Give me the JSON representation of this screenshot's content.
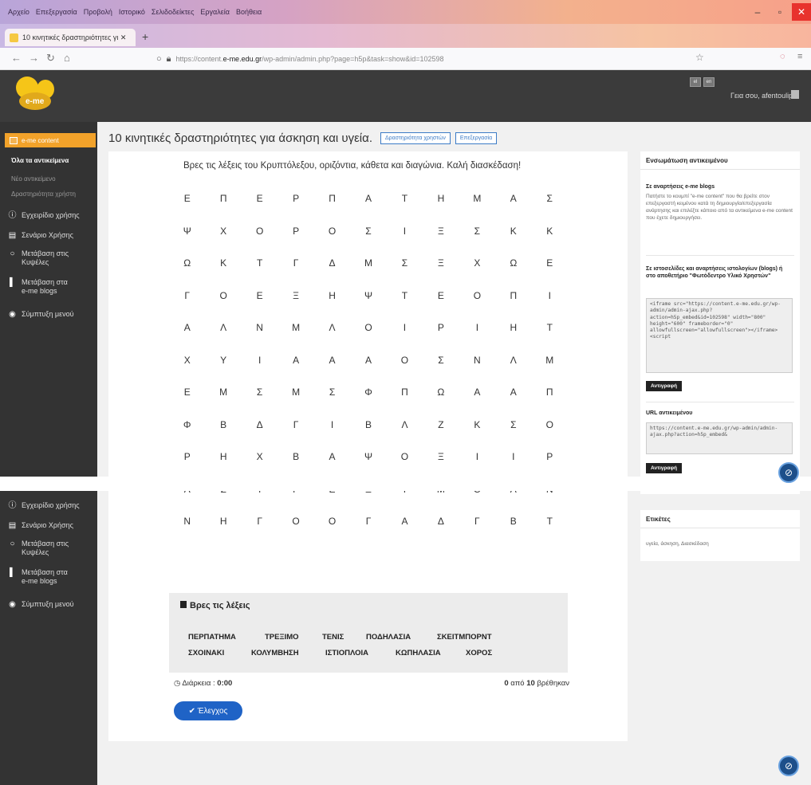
{
  "browser": {
    "menu_items": [
      "Αρχείο",
      "Επεξεργασία",
      "Προβολή",
      "Ιστορικό",
      "Σελιδοδείκτες",
      "Εργαλεία",
      "Βοήθεια"
    ],
    "tab_title": "10 κινητικές δραστηριότητες γι ✕",
    "new_tab": "+",
    "url_prefix": "https://content.",
    "url_domain": "e-me.edu.gr",
    "url_path": "/wp-admin/admin.php?page=h5p&task=show&id=102598",
    "colors": {
      "title_bar_start": "#b9a5d9",
      "title_bar_end": "#f7a089",
      "close_button": "#e8322d"
    }
  },
  "site": {
    "logo_text": "e-me",
    "lang_buttons": [
      "el",
      "en"
    ],
    "greeting": "Γεια σου, afentoulip",
    "accent": "#f2a22a",
    "header_bg": "#3b3b3b"
  },
  "sidebar": {
    "active_item": "e-me content",
    "sub_items": [
      "Όλα τα αντικείμενα",
      "Νέο αντικείμενο",
      "Δραστηριότητα χρήστη"
    ],
    "items_top": [
      {
        "icon": "question-icon",
        "label": "Εγχειρίδιο χρήσης"
      },
      {
        "icon": "document-icon",
        "label": "Σενάριο Χρήσης"
      },
      {
        "icon": "circle-icon",
        "label": "Μετάβαση στις Κυψέλες"
      },
      {
        "icon": "bar-icon",
        "label": "Μετάβαση στα e-me blogs"
      },
      {
        "icon": "collapse-icon",
        "label": "Σύμπτυξη μενού"
      }
    ],
    "items_bottom": [
      {
        "icon": "question-icon",
        "label": "Εγχειρίδιο χρήσης"
      },
      {
        "icon": "document-icon",
        "label": "Σενάριο Χρήσης"
      },
      {
        "icon": "circle-icon",
        "label": "Μετάβαση στις Κυψέλες"
      },
      {
        "icon": "bar-icon",
        "label": "Μετάβαση στα e-me blogs"
      },
      {
        "icon": "collapse-icon",
        "label": "Σύμπτυξη μενού"
      }
    ]
  },
  "main": {
    "title": "10 κινητικές δραστηριότητες για άσκηση και υγεία.",
    "btn_activity": "Δραστηριότητα χρηστών",
    "btn_edit": "Επεξεργασία",
    "instruction": "Βρες τις λέξεις του Κρυπτόλεξου, οριζόντια, κάθετα και διαγώνια. Καλή διασκέδαση!",
    "grid": [
      [
        "Ε",
        "Π",
        "Ε",
        "Ρ",
        "Π",
        "Α",
        "Τ",
        "Η",
        "Μ",
        "Α",
        "Σ"
      ],
      [
        "Ψ",
        "Χ",
        "Ο",
        "Ρ",
        "Ο",
        "Σ",
        "Ι",
        "Ξ",
        "Σ",
        "Κ",
        "Κ"
      ],
      [
        "Ω",
        "Κ",
        "Τ",
        "Γ",
        "Δ",
        "Μ",
        "Σ",
        "Ξ",
        "Χ",
        "Ω",
        "Ε"
      ],
      [
        "Γ",
        "Ο",
        "Ε",
        "Ξ",
        "Η",
        "Ψ",
        "Τ",
        "Ε",
        "Ο",
        "Π",
        "Ι"
      ],
      [
        "Α",
        "Λ",
        "Ν",
        "Μ",
        "Λ",
        "Ο",
        "Ι",
        "Ρ",
        "Ι",
        "Η",
        "Τ"
      ],
      [
        "Χ",
        "Υ",
        "Ι",
        "Α",
        "Α",
        "Α",
        "Ο",
        "Σ",
        "Ν",
        "Λ",
        "Μ"
      ],
      [
        "Ε",
        "Μ",
        "Σ",
        "Μ",
        "Σ",
        "Φ",
        "Π",
        "Ω",
        "Α",
        "Α",
        "Π"
      ],
      [
        "Φ",
        "Β",
        "Δ",
        "Γ",
        "Ι",
        "Β",
        "Λ",
        "Ζ",
        "Κ",
        "Σ",
        "Ο"
      ],
      [
        "Ρ",
        "Η",
        "Χ",
        "Β",
        "Α",
        "Ψ",
        "Ο",
        "Ξ",
        "Ι",
        "Ι",
        "Ρ"
      ],
      [
        "Λ",
        "Σ",
        "Τ",
        "Ρ",
        "Ε",
        "Ξ",
        "Ι",
        "Μ",
        "Ο",
        "Α",
        "Ν"
      ],
      [
        "Ν",
        "Η",
        "Γ",
        "Ο",
        "Ο",
        "Γ",
        "Α",
        "Δ",
        "Γ",
        "Β",
        "Τ"
      ]
    ],
    "words_title": "Βρες τις λέξεις",
    "words_row1": [
      "ΠΕΡΠΑΤΗΜΑ",
      "ΤΡΕΞΙΜΟ",
      "ΤΕΝΙΣ",
      "ΠΟΔΗΛΑΣΙΑ",
      "ΣΚΕΙΤΜΠΟΡΝΤ"
    ],
    "words_row2": [
      "ΣΧΟΙΝΑΚΙ",
      "ΚΟΛΥΜΒΗΣΗ",
      "ΙΣΤΙΟΠΛΟΙΑ",
      "ΚΩΠΗΛΑΣΙΑ",
      "ΧΟΡΟΣ"
    ],
    "timer_label": "Διάρκεια :",
    "timer_value": "0:00",
    "found_count": "0",
    "found_mid": "από",
    "found_total": "10",
    "found_suffix": "βρέθηκαν",
    "check_label": "Έλεγχος",
    "button_color": "#1f63c6"
  },
  "right_panel": {
    "embed_title": "Ενσωμάτωση αντικειμένου",
    "blogs_heading": "Σε αναρτήσεις e-me blogs",
    "blogs_text": "Πατήστε το κουμπί \"e-me content\" που θα βρείτε στον επεξεργαστή κειμένου κατά τη δημιουργία/επεξεργασία ανάρτησης και επιλέξτε κάποιο από τα αντικείμενα e-me content που έχετε δημιουργήσει.",
    "ext_heading": "Σε ιστοσελίδες και αναρτήσεις ιστολογίων (blogs) ή στο αποθετήριο \"Φωτόδεντρο Υλικό Χρηστών\"",
    "iframe_code": "<iframe src=\"https://content.e-me.edu.gr/wp-admin/admin-ajax.php?action=h5p_embed&id=102598\" width=\"800\" height=\"600\" frameborder=\"0\" allowfullscreen=\"allowfullscreen\"></iframe><script",
    "copy_label": "Αντιγραφή",
    "url_heading": "URL αντικειμένου",
    "url_code": "https://content.e-me.edu.gr/wp-admin/admin-ajax.php?action=h5p_embed&",
    "copy_label2": "Αντιγραφή",
    "tags_title": "Ετικέτες",
    "tags": "υγεία, άσκηση, Διασκέδαση"
  }
}
